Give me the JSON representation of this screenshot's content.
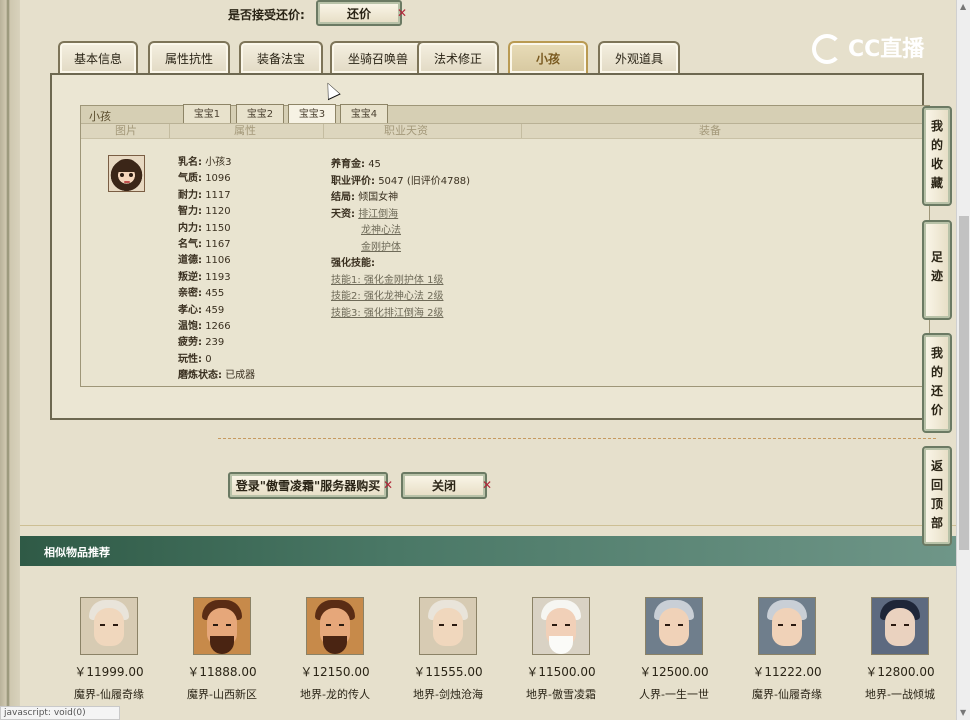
{
  "bargain": {
    "label": "是否接受还价:",
    "button": "还价"
  },
  "tabs": [
    "基本信息",
    "属性抗性",
    "装备法宝",
    "坐骑召唤兽",
    "法术修正",
    "小孩",
    "外观道具"
  ],
  "active_tab": "小孩",
  "child_panel": {
    "title": "小孩",
    "baby_tabs": [
      "宝宝1",
      "宝宝2",
      "宝宝3",
      "宝宝4"
    ],
    "active_baby_tab": "宝宝3",
    "columns": [
      "图片",
      "属性",
      "职业天资",
      "装备"
    ],
    "attributes": [
      {
        "k": "乳名:",
        "v": "小孩3"
      },
      {
        "k": "气质:",
        "v": "1096"
      },
      {
        "k": "耐力:",
        "v": "1117"
      },
      {
        "k": "智力:",
        "v": "1120"
      },
      {
        "k": "内力:",
        "v": "1150"
      },
      {
        "k": "名气:",
        "v": "1167"
      },
      {
        "k": "道德:",
        "v": "1106"
      },
      {
        "k": "叛逆:",
        "v": "1193"
      },
      {
        "k": "亲密:",
        "v": "455"
      },
      {
        "k": "孝心:",
        "v": "459"
      },
      {
        "k": "温饱:",
        "v": "1266"
      },
      {
        "k": "疲劳:",
        "v": "239"
      },
      {
        "k": "玩性:",
        "v": "0"
      },
      {
        "k": "磨炼状态:",
        "v": "已成器"
      }
    ],
    "career": {
      "fund_label": "养育金:",
      "fund_value": "45",
      "eval_label": "职业评价:",
      "eval_value": "5047 (旧评价4788)",
      "ending_label": "结局:",
      "ending_value": "倾国女神",
      "talent_label": "天资:",
      "talents": [
        "排江倒海",
        "龙神心法",
        "金刚护体"
      ],
      "skills_label": "强化技能:",
      "skills": [
        "技能1: 强化金刚护体 1级",
        "技能2: 强化龙神心法 2级",
        "技能3: 强化排江倒海 2级"
      ]
    }
  },
  "actions": {
    "login_buy": "登录\"傲雪凌霜\"服务器购买",
    "close": "关闭"
  },
  "similar": {
    "title": "相似物品推荐",
    "items": [
      {
        "price": "￥11999.00",
        "server": "魔界-仙履奇缘",
        "portrait": "pale-hair"
      },
      {
        "price": "￥11888.00",
        "server": "魔界-山西新区",
        "portrait": "warrior"
      },
      {
        "price": "￥12150.00",
        "server": "地界-龙的传人",
        "portrait": "warrior"
      },
      {
        "price": "￥11555.00",
        "server": "地界-剑烛沧海",
        "portrait": "pale-hair"
      },
      {
        "price": "￥11500.00",
        "server": "地界-傲雪凌霜",
        "portrait": "elder"
      },
      {
        "price": "￥12500.00",
        "server": "人界-一生一世",
        "portrait": "silver-crown"
      },
      {
        "price": "￥11222.00",
        "server": "魔界-仙履奇缘",
        "portrait": "silver-crown"
      },
      {
        "price": "￥12800.00",
        "server": "地界-一战倾城",
        "portrait": "dark-hair"
      }
    ]
  },
  "side_nav": [
    "我的收藏",
    "足迹",
    "我的还价",
    "返回顶部"
  ],
  "watermark": "CC直播",
  "status_bar": "javascript: void(0)"
}
